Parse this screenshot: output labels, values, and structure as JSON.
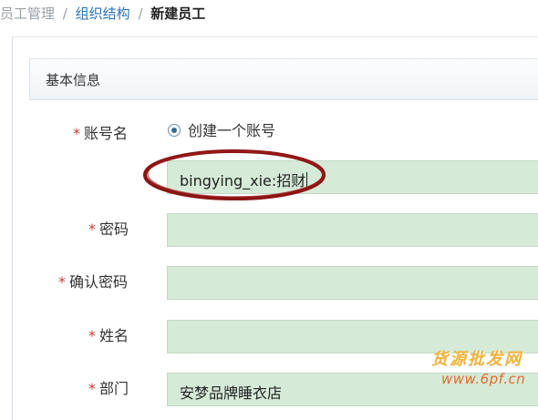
{
  "breadcrumb": {
    "item1": "员工管理",
    "sep1": "/",
    "item2": "组织结构",
    "sep2": "/",
    "current": "新建员工"
  },
  "section": {
    "title": "基本信息"
  },
  "form": {
    "required_mark": "*",
    "account": {
      "label": "账号名",
      "radio_label": "创建一个账号",
      "value": "bingying_xie:招财"
    },
    "password": {
      "label": "密码",
      "value": ""
    },
    "confirm_password": {
      "label": "确认密码",
      "value": ""
    },
    "name": {
      "label": "姓名",
      "value": ""
    },
    "department": {
      "label": "部门",
      "value": "安梦品牌睡衣店"
    }
  },
  "watermark": {
    "line1": "货源批发网",
    "line2": "www.6pf.cn"
  },
  "colors": {
    "field_bg": "#d5ead7",
    "required": "#d23b2f",
    "annotation": "#8b1414",
    "link": "#2a73b8"
  }
}
